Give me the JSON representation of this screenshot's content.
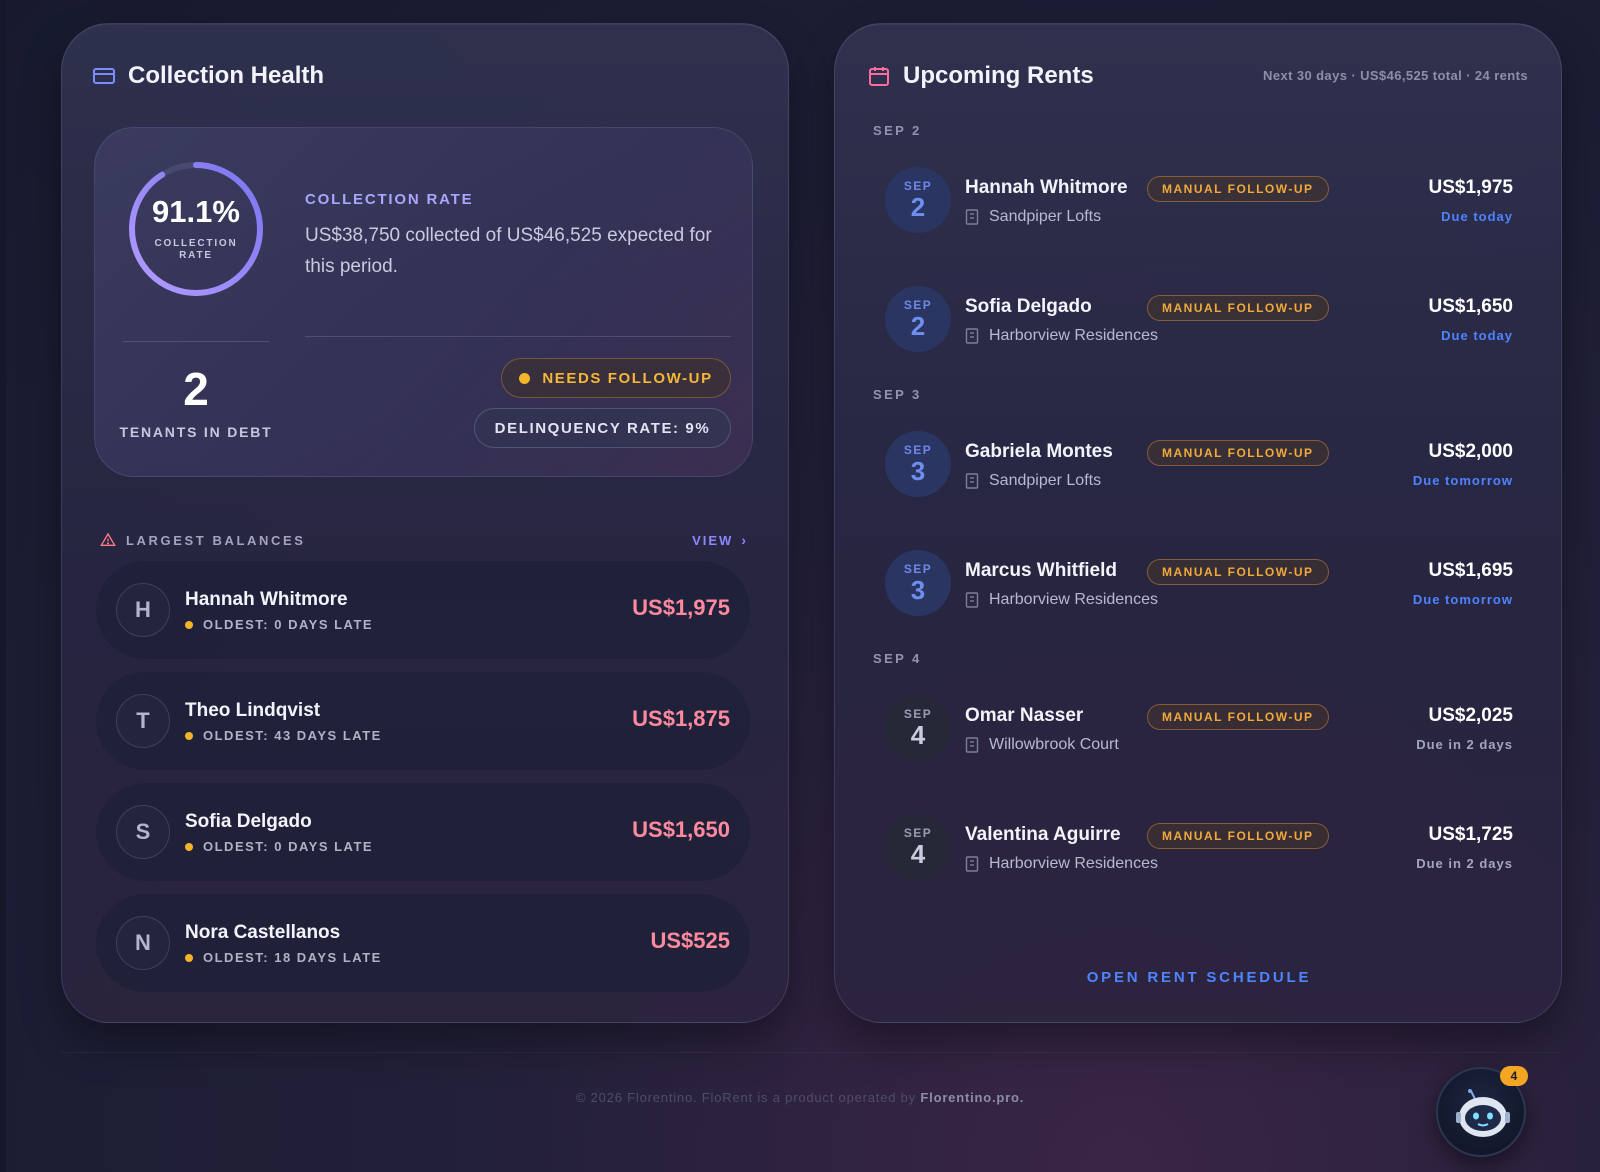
{
  "collection_health": {
    "title": "Collection Health",
    "rate_percent": "91.1%",
    "rate_value": 0.911,
    "rate_label_1": "COLLECTION",
    "rate_label_2": "RATE",
    "section_label": "COLLECTION RATE",
    "description": "US$38,750 collected of US$46,525 expected for this period.",
    "tenants_in_debt": "2",
    "tenants_in_debt_label": "TENANTS IN DEBT",
    "status_pill": "NEEDS FOLLOW-UP",
    "delinquency_pill": "DELINQUENCY RATE: 9%",
    "accent_color": "#a08cff"
  },
  "largest_balances": {
    "title": "LARGEST BALANCES",
    "view_label": "VIEW",
    "items": [
      {
        "initial": "H",
        "name": "Hannah Whitmore",
        "oldest": "OLDEST: 0 DAYS LATE",
        "amount": "US$1,975"
      },
      {
        "initial": "T",
        "name": "Theo Lindqvist",
        "oldest": "OLDEST: 43 DAYS LATE",
        "amount": "US$1,875"
      },
      {
        "initial": "S",
        "name": "Sofia Delgado",
        "oldest": "OLDEST: 0 DAYS LATE",
        "amount": "US$1,650"
      },
      {
        "initial": "N",
        "name": "Nora Castellanos",
        "oldest": "OLDEST: 18 DAYS LATE",
        "amount": "US$525"
      }
    ]
  },
  "upcoming_rents": {
    "title": "Upcoming Rents",
    "meta": "Next 30 days · US$46,525 total · 24 rents",
    "groups": [
      {
        "date_label": "SEP 2",
        "items": [
          {
            "month": "SEP",
            "day": "2",
            "name": "Hannah Whitmore",
            "tag": "MANUAL FOLLOW-UP",
            "property": "Sandpiper Lofts",
            "amount": "US$1,975",
            "due": "Due today",
            "style": "blue"
          },
          {
            "month": "SEP",
            "day": "2",
            "name": "Sofia Delgado",
            "tag": "MANUAL FOLLOW-UP",
            "property": "Harborview Residences",
            "amount": "US$1,650",
            "due": "Due today",
            "style": "blue"
          }
        ]
      },
      {
        "date_label": "SEP 3",
        "items": [
          {
            "month": "SEP",
            "day": "3",
            "name": "Gabriela Montes",
            "tag": "MANUAL FOLLOW-UP",
            "property": "Sandpiper Lofts",
            "amount": "US$2,000",
            "due": "Due tomorrow",
            "style": "blue"
          },
          {
            "month": "SEP",
            "day": "3",
            "name": "Marcus Whitfield",
            "tag": "MANUAL FOLLOW-UP",
            "property": "Harborview Residences",
            "amount": "US$1,695",
            "due": "Due tomorrow",
            "style": "blue"
          }
        ]
      },
      {
        "date_label": "SEP 4",
        "items": [
          {
            "month": "SEP",
            "day": "4",
            "name": "Omar Nasser",
            "tag": "MANUAL FOLLOW-UP",
            "property": "Willowbrook Court",
            "amount": "US$2,025",
            "due": "Due in 2 days",
            "style": "grey"
          },
          {
            "month": "SEP",
            "day": "4",
            "name": "Valentina Aguirre",
            "tag": "MANUAL FOLLOW-UP",
            "property": "Harborview Residences",
            "amount": "US$1,725",
            "due": "Due in 2 days",
            "style": "grey"
          }
        ]
      }
    ],
    "open_schedule_label": "OPEN RENT SCHEDULE"
  },
  "footer": {
    "text": "© 2026 Florentino. FloRent is a product operated by ",
    "brand": "Florentino.pro."
  },
  "assistant": {
    "icon": "robot-icon",
    "badge_count": "4"
  }
}
